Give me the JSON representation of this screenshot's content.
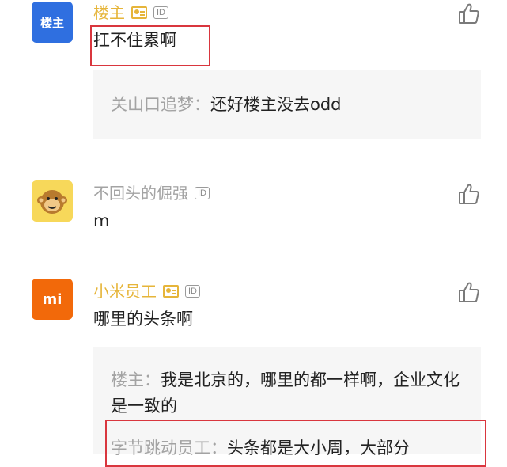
{
  "comments": [
    {
      "avatar_text": "楼主",
      "avatar_color": "#2f6fe0",
      "name": "楼主",
      "name_color": "#e6b53a",
      "verified": true,
      "id_badge": "ID",
      "text": "扛不住累啊",
      "replies": [
        {
          "name": "关山口追梦",
          "sep": "：",
          "text": "还好楼主没去odd"
        }
      ]
    },
    {
      "avatar_icon": "monkey-icon",
      "name": "不回头的倔强",
      "name_color": "#a3a3a3",
      "verified": false,
      "id_badge": "ID",
      "text": "m",
      "replies": []
    },
    {
      "avatar_text": "mi",
      "avatar_color": "#f2690a",
      "name": "小米员工",
      "name_color": "#e6b53a",
      "verified": true,
      "id_badge": "ID",
      "text": "哪里的头条啊",
      "replies": [
        {
          "name": "楼主",
          "sep": "：",
          "text": "我是北京的，哪里的都一样啊，企业文化是一致的"
        },
        {
          "name": "字节跳动员工",
          "sep": "：",
          "text": "头条都是大小周，大部分"
        }
      ]
    }
  ],
  "colors": {
    "highlight": "#d9363e",
    "reply_bg": "#f6f6f6",
    "reply_name": "#a3a3a3"
  }
}
